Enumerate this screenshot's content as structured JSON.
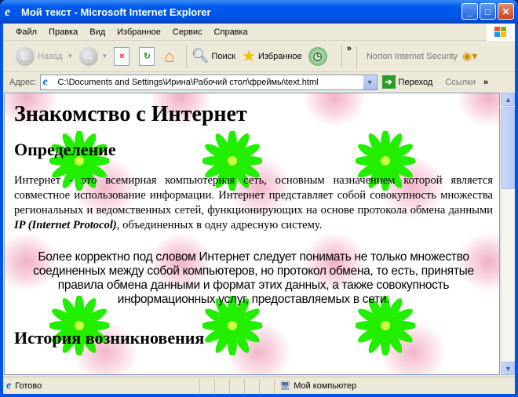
{
  "window": {
    "title": "Мой текст - Microsoft Internet Explorer"
  },
  "menu": [
    "Файл",
    "Правка",
    "Вид",
    "Избранное",
    "Сервис",
    "Справка"
  ],
  "toolbar": {
    "back": "Назад",
    "search": "Поиск",
    "favorites": "Избранное",
    "norton": "Norton Internet Security",
    "more": "»"
  },
  "address": {
    "label": "Адрес:",
    "value": "C:\\Documents and Settings\\Ирина\\Рабочий стол\\фреймы\\text.html",
    "go": "Переход",
    "links": "Ссылки",
    "more": "»"
  },
  "page": {
    "h1": "Знакомство с Интернет",
    "h2_definition": "Определение",
    "p1_before": "Интернет - это всемирная компьютерная сеть, основным назначением которой является совместное использование информации. Интернет представляет собой совокупность множества региональных и ведомственных сетей, функционирующих на основе протокола обмена данными ",
    "p1_em": "IP (Internet Protocol)",
    "p1_after": ", объединенных в одну адресную систему.",
    "p2": "Более корректно под словом Интернет следует понимать не только множество соединенных между собой компьютеров, но протокол обмена, то есть, принятые правила обмена данными и формат этих данных, а также совокупность информационных услуг, предоставляемых в сети.",
    "h2_history": "История возникновения"
  },
  "status": {
    "text": "Готово",
    "zone": "Мой компьютер"
  }
}
